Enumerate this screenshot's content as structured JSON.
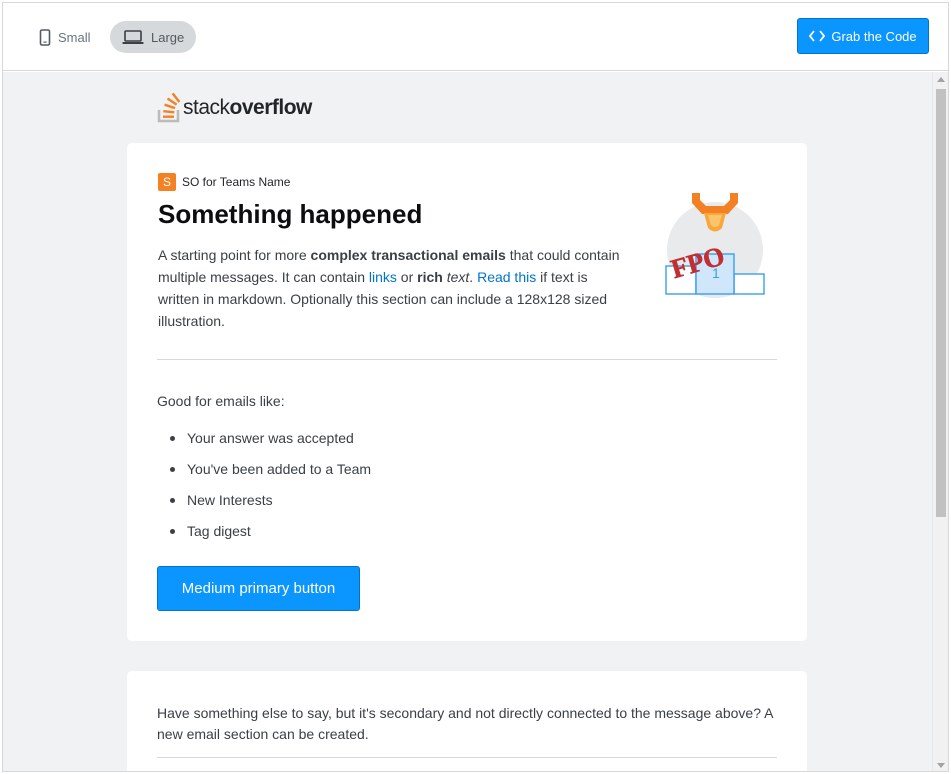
{
  "toolbar": {
    "small_label": "Small",
    "large_label": "Large",
    "grab_code_label": "Grab the Code"
  },
  "logo": {
    "text_light": "stack",
    "text_bold": "overflow"
  },
  "card1": {
    "team_badge": "S",
    "team_name": "SO for Teams Name",
    "headline": "Something happened",
    "intro": {
      "p1": "A starting point for more ",
      "b1": "complex transactional emails",
      "p2": " that could contain multiple messages. It can contain ",
      "link1": "links",
      "p3": " or ",
      "b2": "rich",
      "p4": " ",
      "i1": "text",
      "p5": ". ",
      "link2": "Read this",
      "p6": " if text is written in markdown. Optionally this section can include a 128x128 sized illustration."
    },
    "illustration_text": "FPO",
    "good_for": "Good for emails like:",
    "bullets": [
      "Your answer was accepted",
      "You've been added to a Team",
      "New Interests",
      "Tag digest"
    ],
    "button_label": "Medium primary button"
  },
  "card2": {
    "text": "Have something else to say, but it's secondary and not directly connected to the message above? A new email section can be created."
  },
  "colors": {
    "primary": "#0a95ff",
    "brand_orange": "#f48225",
    "link": "#0074cc"
  }
}
